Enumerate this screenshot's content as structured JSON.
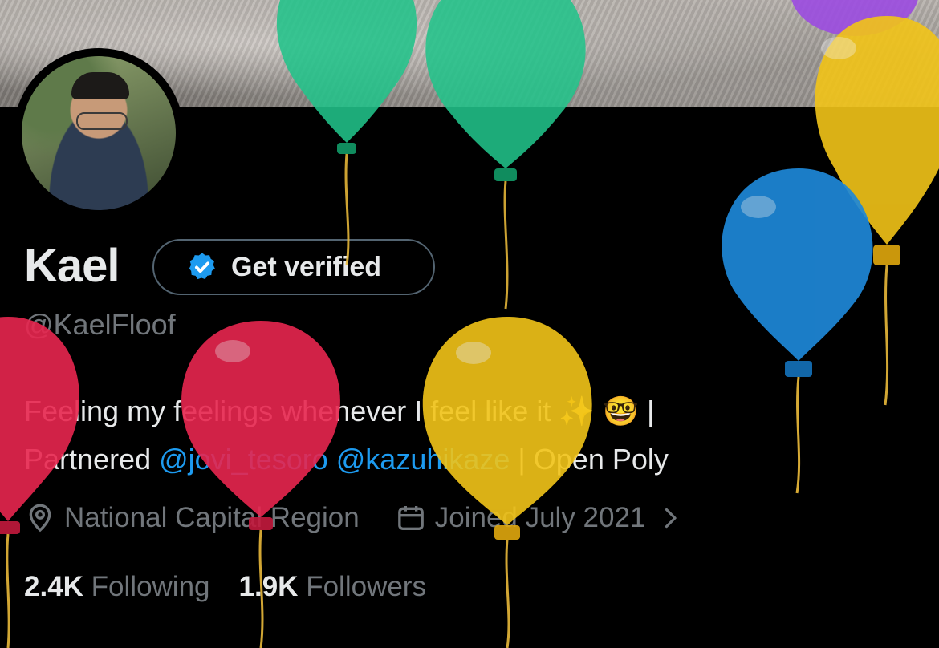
{
  "profile": {
    "name": "Kael",
    "handle": "@KaelFloof",
    "verify_button": "Get verified",
    "bio_line1": "Feeling my feelings whenever I feel like it ✨ 🤓 |",
    "bio_line2_prefix": "Partnered ",
    "mention1": "@jovi_tesoro",
    "mention2": "@kazuhikaze",
    "bio_line2_suffix": " | Open Poly",
    "location": "National Capital Region",
    "joined": "Joined July 2021",
    "following_count": "2.4K",
    "following_label": "Following",
    "followers_count": "1.9K",
    "followers_label": "Followers"
  },
  "icons": {
    "verify": "verified-badge-icon",
    "location": "location-pin-icon",
    "calendar": "calendar-icon",
    "chevron": "chevron-right-icon"
  },
  "colors": {
    "accent": "#1d9bf0",
    "secondary_text": "#71767b",
    "balloon_green": "#22c38a",
    "balloon_yellow": "#f2c418",
    "balloon_blue": "#1e88d8",
    "balloon_red": "#e8264f",
    "balloon_purple": "#9b4be0"
  }
}
